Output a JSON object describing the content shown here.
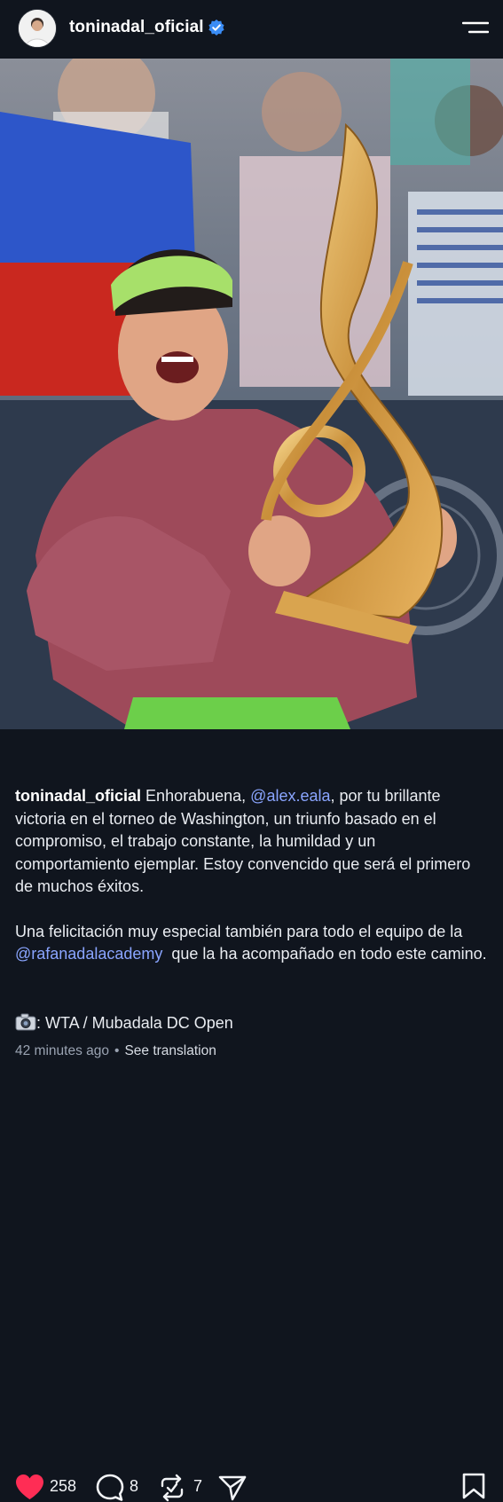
{
  "header": {
    "username": "toninadal_oficial"
  },
  "actions": {
    "likes": "258",
    "comments": "8",
    "reposts": "7"
  },
  "caption": {
    "owner": "toninadal_oficial",
    "p1_a": "Enhorabuena,",
    "mention1": "@alex.eala",
    "p1_b": ", por tu brillante victoria en el torneo de Washington, un triunfo basado en el compromiso, el trabajo constante, la humildad y un comportamiento ejemplar. Estoy convencido que será el primero de muchos éxitos.",
    "p2_a": "Una felicitación muy especial también para todo el equipo de la",
    "mention2": "@rafanadalacademy",
    "p2_b": " que la ha acompañado en todo este camino."
  },
  "source": {
    "text": ": WTA / Mubadala DC Open"
  },
  "meta": {
    "time": "42 minutes ago",
    "translate": "See translation"
  }
}
